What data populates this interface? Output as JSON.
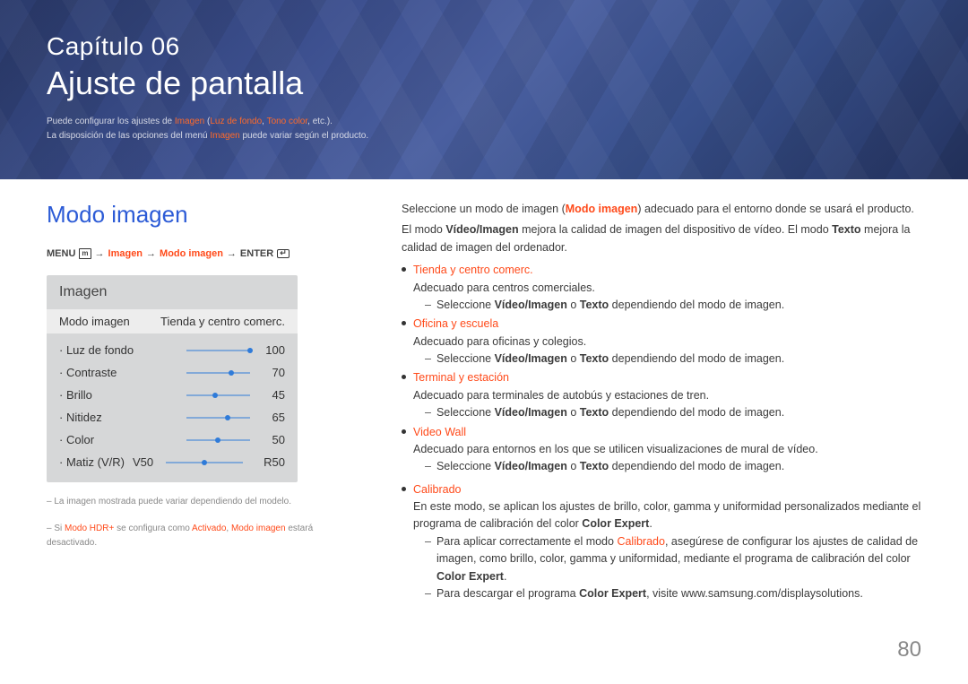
{
  "banner": {
    "chapter_label": "Capítulo 06",
    "chapter_title": "Ajuste de pantalla",
    "intro1_pre": "Puede configurar los ajustes de ",
    "intro1_w1": "Imagen",
    "intro1_paren_open": " (",
    "intro1_w2": "Luz de fondo",
    "intro1_sep1": ", ",
    "intro1_w3": "Tono color",
    "intro1_post": ", etc.).",
    "intro2_pre": "La disposición de las opciones del menú ",
    "intro2_w1": "Imagen",
    "intro2_post": " puede variar según el producto."
  },
  "left": {
    "h2": "Modo imagen",
    "bc_menu": "MENU",
    "bc_menu_icon": "m",
    "bc_arrow": "→",
    "bc_w1": "Imagen",
    "bc_w2": "Modo imagen",
    "bc_enter": "ENTER",
    "panel_header": "Imagen",
    "sel_label": "Modo imagen",
    "sel_value": "Tienda y centro comerc.",
    "rows": [
      {
        "label": "Luz de fondo",
        "value": "100",
        "pos": 100
      },
      {
        "label": "Contraste",
        "value": "70",
        "pos": 70
      },
      {
        "label": "Brillo",
        "value": "45",
        "pos": 45
      },
      {
        "label": "Nitidez",
        "value": "65",
        "pos": 65
      },
      {
        "label": "Color",
        "value": "50",
        "pos": 50
      }
    ],
    "matiz_label": "Matiz (V/R)",
    "matiz_v": "V50",
    "matiz_r": "R50",
    "note1": "La imagen mostrada puede variar dependiendo del modelo.",
    "note2_pre": "Si ",
    "note2_w1": "Modo HDR+",
    "note2_mid": " se configura como ",
    "note2_w2": "Activado",
    "note2_sep": ", ",
    "note2_w3": "Modo imagen",
    "note2_post": " estará desactivado."
  },
  "right": {
    "p1_pre": "Seleccione un modo de imagen (",
    "p1_b": "Modo imagen",
    "p1_post": ") adecuado para el entorno donde se usará el producto.",
    "p2_pre": "El modo ",
    "p2_b1": "Vídeo/Imagen",
    "p2_mid1": " mejora la calidad de imagen del dispositivo de vídeo. El modo ",
    "p2_b2": "Texto",
    "p2_post": " mejora la calidad de imagen del ordenador.",
    "sel_pre": "Seleccione ",
    "sel_b1": "Vídeo/Imagen",
    "sel_mid": " o ",
    "sel_b2": "Texto",
    "sel_post": " dependiendo del modo de imagen.",
    "items": [
      {
        "title": "Tienda y centro comerc.",
        "desc": "Adecuado para centros comerciales.",
        "sel": true
      },
      {
        "title": "Oficina y escuela",
        "desc": "Adecuado para oficinas y colegios.",
        "sel": true
      },
      {
        "title": "Terminal y estación",
        "desc": "Adecuado para terminales de autobús y estaciones de tren.",
        "sel": true
      },
      {
        "title": "Video Wall",
        "desc": "Adecuado para entornos en los que se utilicen visualizaciones de mural de vídeo.",
        "sel": true
      }
    ],
    "cal_title": "Calibrado",
    "cal_desc_pre": "En este modo, se aplican los ajustes de brillo, color, gamma y uniformidad personalizados mediante el programa de calibración del color ",
    "cal_desc_b": "Color Expert",
    "cal_desc_post": ".",
    "cal_n1_pre": "Para aplicar correctamente el modo ",
    "cal_n1_w": "Calibrado",
    "cal_n1_mid": ", asegúrese de configurar los ajustes de calidad de imagen, como brillo, color, gamma y uniformidad, mediante el programa de calibración del color ",
    "cal_n1_b": "Color Expert",
    "cal_n1_post": ".",
    "cal_n2_pre": "Para descargar el programa ",
    "cal_n2_b": "Color Expert",
    "cal_n2_post": ", visite www.samsung.com/displaysolutions."
  },
  "page_number": "80"
}
